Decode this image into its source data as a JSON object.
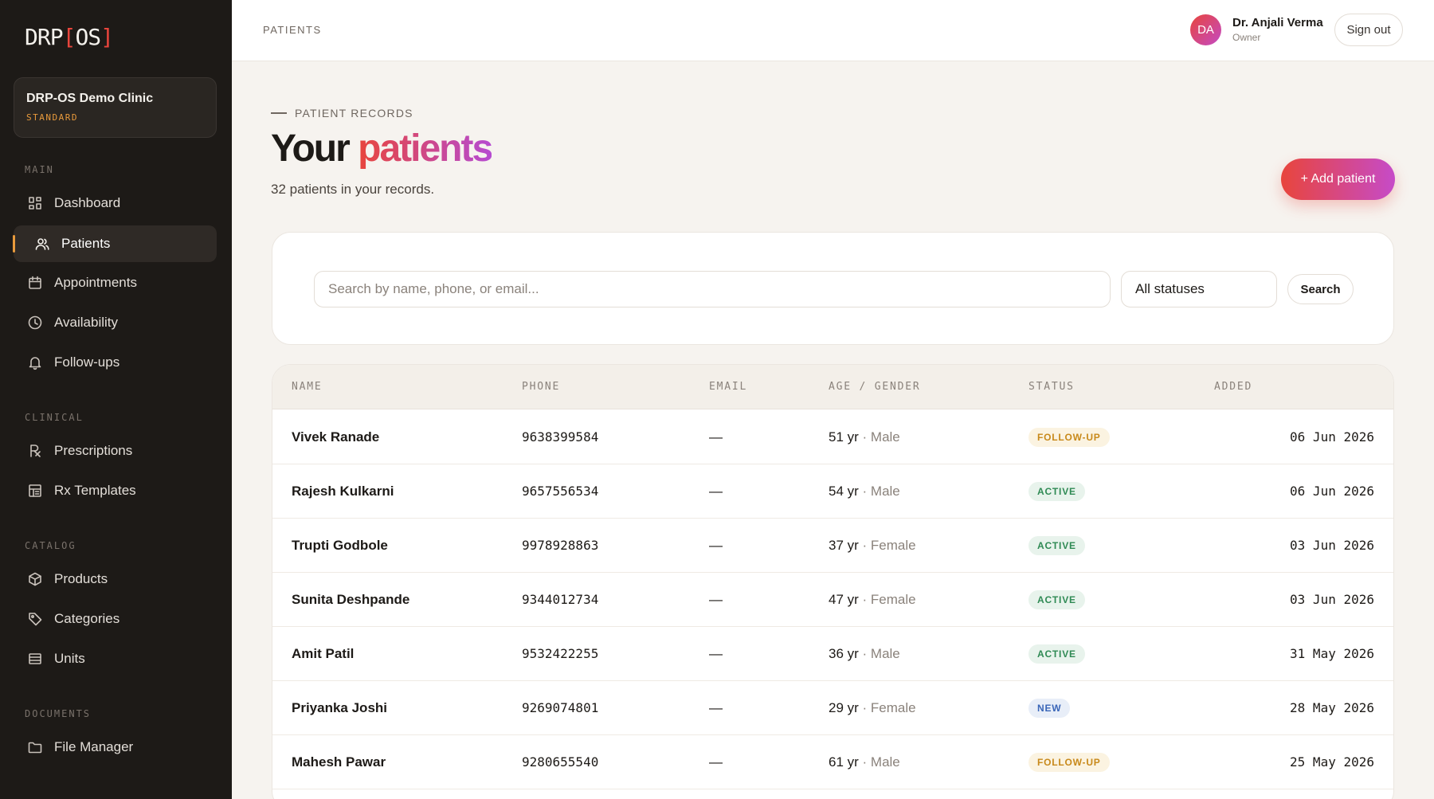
{
  "sidebar": {
    "logo_main": "DRP",
    "logo_bracket_open": "[",
    "logo_os": "OS",
    "logo_bracket_close": "]",
    "clinic": {
      "name": "DRP-OS Demo Clinic",
      "plan": "STANDARD"
    },
    "sections": {
      "main": "MAIN",
      "clinical": "CLINICAL",
      "catalog": "CATALOG",
      "documents": "DOCUMENTS"
    },
    "items": {
      "dashboard": {
        "label": "Dashboard",
        "icon": "grid-icon"
      },
      "patients": {
        "label": "Patients",
        "icon": "users-icon",
        "active": true
      },
      "appointments": {
        "label": "Appointments",
        "icon": "calendar-icon"
      },
      "availability": {
        "label": "Availability",
        "icon": "clock-icon"
      },
      "followups": {
        "label": "Follow-ups",
        "icon": "bell-icon"
      },
      "prescriptions": {
        "label": "Prescriptions",
        "icon": "rx-icon"
      },
      "rx_templates": {
        "label": "Rx Templates",
        "icon": "template-icon"
      },
      "products": {
        "label": "Products",
        "icon": "box-icon"
      },
      "categories": {
        "label": "Categories",
        "icon": "tag-icon"
      },
      "units": {
        "label": "Units",
        "icon": "units-icon"
      },
      "file_manager": {
        "label": "File Manager",
        "icon": "folder-icon"
      }
    }
  },
  "header": {
    "breadcrumb": "PATIENTS",
    "user": {
      "initials": "DA",
      "name": "Dr. Anjali Verma",
      "role": "Owner"
    },
    "signout_label": "Sign out"
  },
  "main": {
    "eyebrow": "PATIENT RECORDS",
    "title_plain": "Your",
    "title_accent": "patients",
    "subtitle": "32 patients in your records.",
    "add_label": "+ Add patient",
    "search": {
      "placeholder": "Search by name, phone, or email...",
      "value": "",
      "status_selected": "All statuses",
      "button_label": "Search"
    },
    "table": {
      "headers": {
        "name": "NAME",
        "phone": "PHONE",
        "email": "EMAIL",
        "age_gender": "AGE / GENDER",
        "status": "STATUS",
        "added": "ADDED"
      },
      "rows": [
        {
          "name": "Vivek Ranade",
          "phone": "9638399584",
          "email": "—",
          "age": "51 yr",
          "sep": " · ",
          "gender": "Male",
          "status": "FOLLOW-UP",
          "status_kind": "follow",
          "added": "06 Jun 2026"
        },
        {
          "name": "Rajesh Kulkarni",
          "phone": "9657556534",
          "email": "—",
          "age": "54 yr",
          "sep": " · ",
          "gender": "Male",
          "status": "ACTIVE",
          "status_kind": "active",
          "added": "06 Jun 2026"
        },
        {
          "name": "Trupti Godbole",
          "phone": "9978928863",
          "email": "—",
          "age": "37 yr",
          "sep": " · ",
          "gender": "Female",
          "status": "ACTIVE",
          "status_kind": "active",
          "added": "03 Jun 2026"
        },
        {
          "name": "Sunita Deshpande",
          "phone": "9344012734",
          "email": "—",
          "age": "47 yr",
          "sep": " · ",
          "gender": "Female",
          "status": "ACTIVE",
          "status_kind": "active",
          "added": "03 Jun 2026"
        },
        {
          "name": "Amit Patil",
          "phone": "9532422255",
          "email": "—",
          "age": "36 yr",
          "sep": " · ",
          "gender": "Male",
          "status": "ACTIVE",
          "status_kind": "active",
          "added": "31 May 2026"
        },
        {
          "name": "Priyanka Joshi",
          "phone": "9269074801",
          "email": "—",
          "age": "29 yr",
          "sep": " · ",
          "gender": "Female",
          "status": "NEW",
          "status_kind": "new",
          "added": "28 May 2026"
        },
        {
          "name": "Mahesh Pawar",
          "phone": "9280655540",
          "email": "—",
          "age": "61 yr",
          "sep": " · ",
          "gender": "Male",
          "status": "FOLLOW-UP",
          "status_kind": "follow",
          "added": "25 May 2026"
        }
      ]
    }
  },
  "colors": {
    "sidebar_bg": "#1d1a17",
    "accent_red": "#e8453c",
    "accent_purple": "#b64bd1",
    "accent_orange": "#e89a3c",
    "status_follow": "#c8891a",
    "status_active": "#2f8a54",
    "status_new": "#3a66b8"
  }
}
